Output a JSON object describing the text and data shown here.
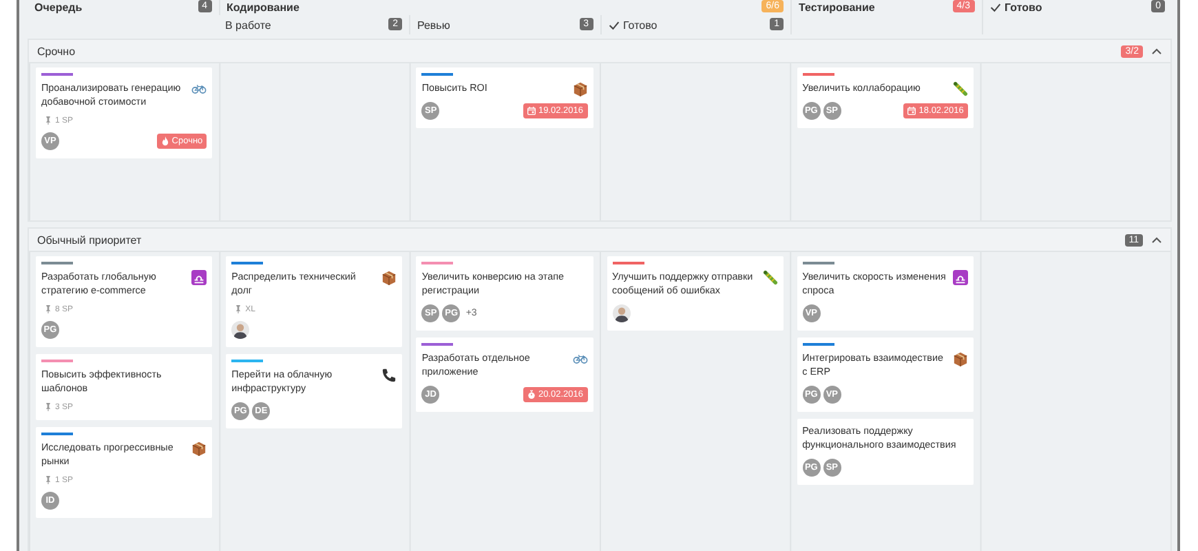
{
  "columns": [
    {
      "title": "Очередь",
      "count": "4",
      "at_limit": false,
      "over_limit": false,
      "done": false
    },
    {
      "title": "Кодирование",
      "count": "6/6",
      "at_limit": true,
      "over_limit": false,
      "done": false,
      "children": [
        {
          "title": "В работе",
          "count": "2",
          "at_limit": false,
          "over_limit": false,
          "done": false
        },
        {
          "title": "Ревью",
          "count": "3",
          "at_limit": false,
          "over_limit": false,
          "done": false
        },
        {
          "title": "Готово",
          "count": "1",
          "at_limit": false,
          "over_limit": false,
          "done": true
        }
      ]
    },
    {
      "title": "Тестирование",
      "count": "4/3",
      "at_limit": false,
      "over_limit": true,
      "done": false
    },
    {
      "title": "Готово",
      "count": "0",
      "at_limit": false,
      "over_limit": false,
      "done": true
    }
  ],
  "lanes": [
    {
      "title": "Срочно",
      "count": "3/2",
      "at_limit": false,
      "over_limit": true,
      "expanded": true,
      "cells": [
        [
          {
            "title": "Проанализировать генерацию добавочной стоимости",
            "color": "#9c5fd6",
            "kind": "bike",
            "estimate": "1 SP",
            "avatars": [
              {
                "initials": "VP"
              }
            ],
            "tag": {
              "kind": "urgent",
              "text": "Срочно"
            }
          }
        ],
        [],
        [
          {
            "title": "Повысить ROI",
            "color": "#1e7fd8",
            "kind": "box",
            "avatars": [
              {
                "initials": "SP"
              }
            ],
            "tag": {
              "kind": "due",
              "text": "19.02.2016"
            }
          }
        ],
        [],
        [
          {
            "title": "Увеличить коллаборацию",
            "color": "#f06464",
            "kind": "bug",
            "avatars": [
              {
                "initials": "PG"
              },
              {
                "initials": "SP"
              }
            ],
            "tag": {
              "kind": "due",
              "text": "18.02.2016"
            }
          }
        ],
        []
      ]
    },
    {
      "title": "Обычный приоритет",
      "count": "11",
      "at_limit": false,
      "over_limit": false,
      "expanded": true,
      "cells": [
        [
          {
            "title": "Разработать глобальную стратегию e-commerce",
            "color": "#7c8c94",
            "kind": "libra",
            "estimate": "8 SP",
            "avatars": [
              {
                "initials": "PG"
              }
            ]
          },
          {
            "title": "Повысить эффективность шаблонов",
            "color": "#f48fb1",
            "estimate": "3 SP"
          },
          {
            "title": "Исследовать прогрессивные рынки",
            "color": "#1e7fd8",
            "kind": "box",
            "estimate": "1 SP",
            "avatars": [
              {
                "initials": "ID"
              }
            ]
          }
        ],
        [
          {
            "title": "Распределить технический долг",
            "color": "#1e7fd8",
            "kind": "box",
            "estimate": "XL",
            "avatars": [
              {
                "kind": "photo"
              }
            ]
          },
          {
            "title": "Перейти на облачную инфраструктуру",
            "color": "#2cb5f0",
            "kind": "phone",
            "avatars": [
              {
                "initials": "PG"
              },
              {
                "initials": "DE"
              }
            ]
          }
        ],
        [
          {
            "title": "Увеличить конверсию на этапе регистрации",
            "color": "#f48fb1",
            "avatars": [
              {
                "initials": "SP"
              },
              {
                "initials": "PG"
              }
            ],
            "more": "+3"
          },
          {
            "title": "Разработать отдельное приложение",
            "color": "#9c5fd6",
            "kind": "bike",
            "avatars": [
              {
                "initials": "JD"
              }
            ],
            "tag": {
              "kind": "overdue",
              "text": "20.02.2016"
            }
          }
        ],
        [
          {
            "title": "Улучшить поддержку отправки сообщений об ошибках",
            "color": "#f06464",
            "kind": "bug",
            "avatars": [
              {
                "kind": "photo"
              }
            ]
          }
        ],
        [
          {
            "title": "Увеличить скорость изменения спроса",
            "color": "#7c8c94",
            "kind": "libra",
            "avatars": [
              {
                "initials": "VP"
              }
            ]
          },
          {
            "title": "Интегрировать взаимодествие с ERP",
            "color": "#1e7fd8",
            "kind": "box",
            "avatars": [
              {
                "initials": "PG"
              },
              {
                "initials": "VP"
              }
            ]
          },
          {
            "title": "Реализовать поддержку функционального взаимодествия",
            "avatars": [
              {
                "initials": "PG"
              },
              {
                "initials": "SP"
              }
            ]
          }
        ],
        []
      ]
    }
  ]
}
